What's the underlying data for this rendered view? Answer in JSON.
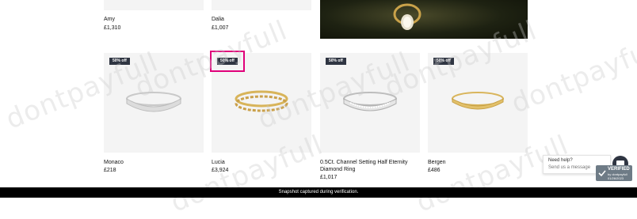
{
  "products_top": [
    {
      "name": "Amy",
      "price": "£1,310"
    },
    {
      "name": "Dalia",
      "price": "£1,007"
    }
  ],
  "products": [
    {
      "badge": "50% off",
      "name": "Monaco",
      "price": "£218"
    },
    {
      "badge": "50% off",
      "name": "Lucia",
      "price": "£3,924"
    },
    {
      "badge": "50% off",
      "name": "0.5Ct. Channel Setting Half Eternity Diamond Ring",
      "price": "£1,017"
    },
    {
      "badge": "50% off",
      "name": "Bergen",
      "price": "£486"
    }
  ],
  "watermark": "dontpayfull",
  "chat": {
    "title": "Need help?",
    "subtitle": "Send us a message"
  },
  "verified": {
    "label": "VERIFIED",
    "by": "by dontpayfull",
    "date": "01/26/2023"
  },
  "footer_text": "Snapshot captured during verification."
}
